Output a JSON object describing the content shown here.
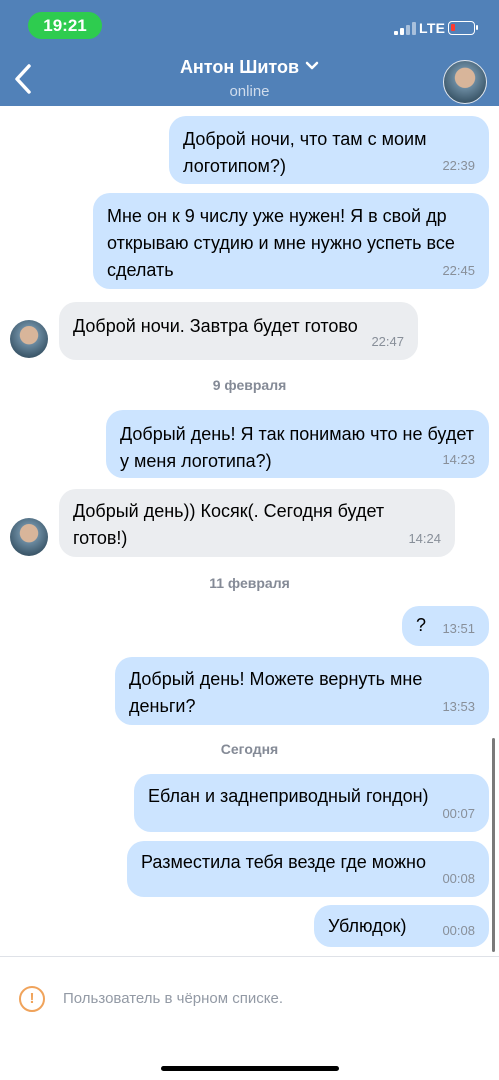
{
  "status_bar": {
    "time": "19:21",
    "network": "LTE",
    "battery_color": "#ff3b30"
  },
  "header": {
    "title": "Антон Шитов",
    "subtitle": "online",
    "accent": "#5181b8"
  },
  "messages": [
    {
      "dir": "out",
      "text": "Доброй ночи, что там с моим логотипом?)",
      "time": "22:39"
    },
    {
      "dir": "out",
      "text": "Мне он к 9 числу уже нужен! Я в свой др открываю студию и мне нужно успеть все сделать",
      "time": "22:45"
    },
    {
      "dir": "in",
      "text": "Доброй ночи. Завтра будет готово",
      "time": "22:47"
    },
    {
      "dir": "out",
      "text": "Добрый день! Я так понимаю что не будет у меня логотипа?)",
      "time": "14:23"
    },
    {
      "dir": "in",
      "text": "Добрый день)) Косяк(. Сегодня будет готов!)",
      "time": "14:24"
    },
    {
      "dir": "out",
      "text": "?",
      "time": "13:51"
    },
    {
      "dir": "out",
      "text": "Добрый день! Можете вернуть мне деньги?",
      "time": "13:53"
    },
    {
      "dir": "out",
      "text": "Еблан и заднеприводный гондон)",
      "time": "00:07"
    },
    {
      "dir": "out",
      "text": "Разместила тебя везде где можно",
      "time": "00:08"
    },
    {
      "dir": "out",
      "text": "Ублюдок)",
      "time": "00:08"
    }
  ],
  "dates": [
    "9 февраля",
    "11 февраля",
    "Сегодня"
  ],
  "footer": {
    "blocked_text": "Пользователь в чёрном списке.",
    "warning_glyph": "!"
  },
  "colors": {
    "outgoing_bubble": "#cce4ff",
    "incoming_bubble": "#ebedf0",
    "warning": "#f0a35b"
  }
}
